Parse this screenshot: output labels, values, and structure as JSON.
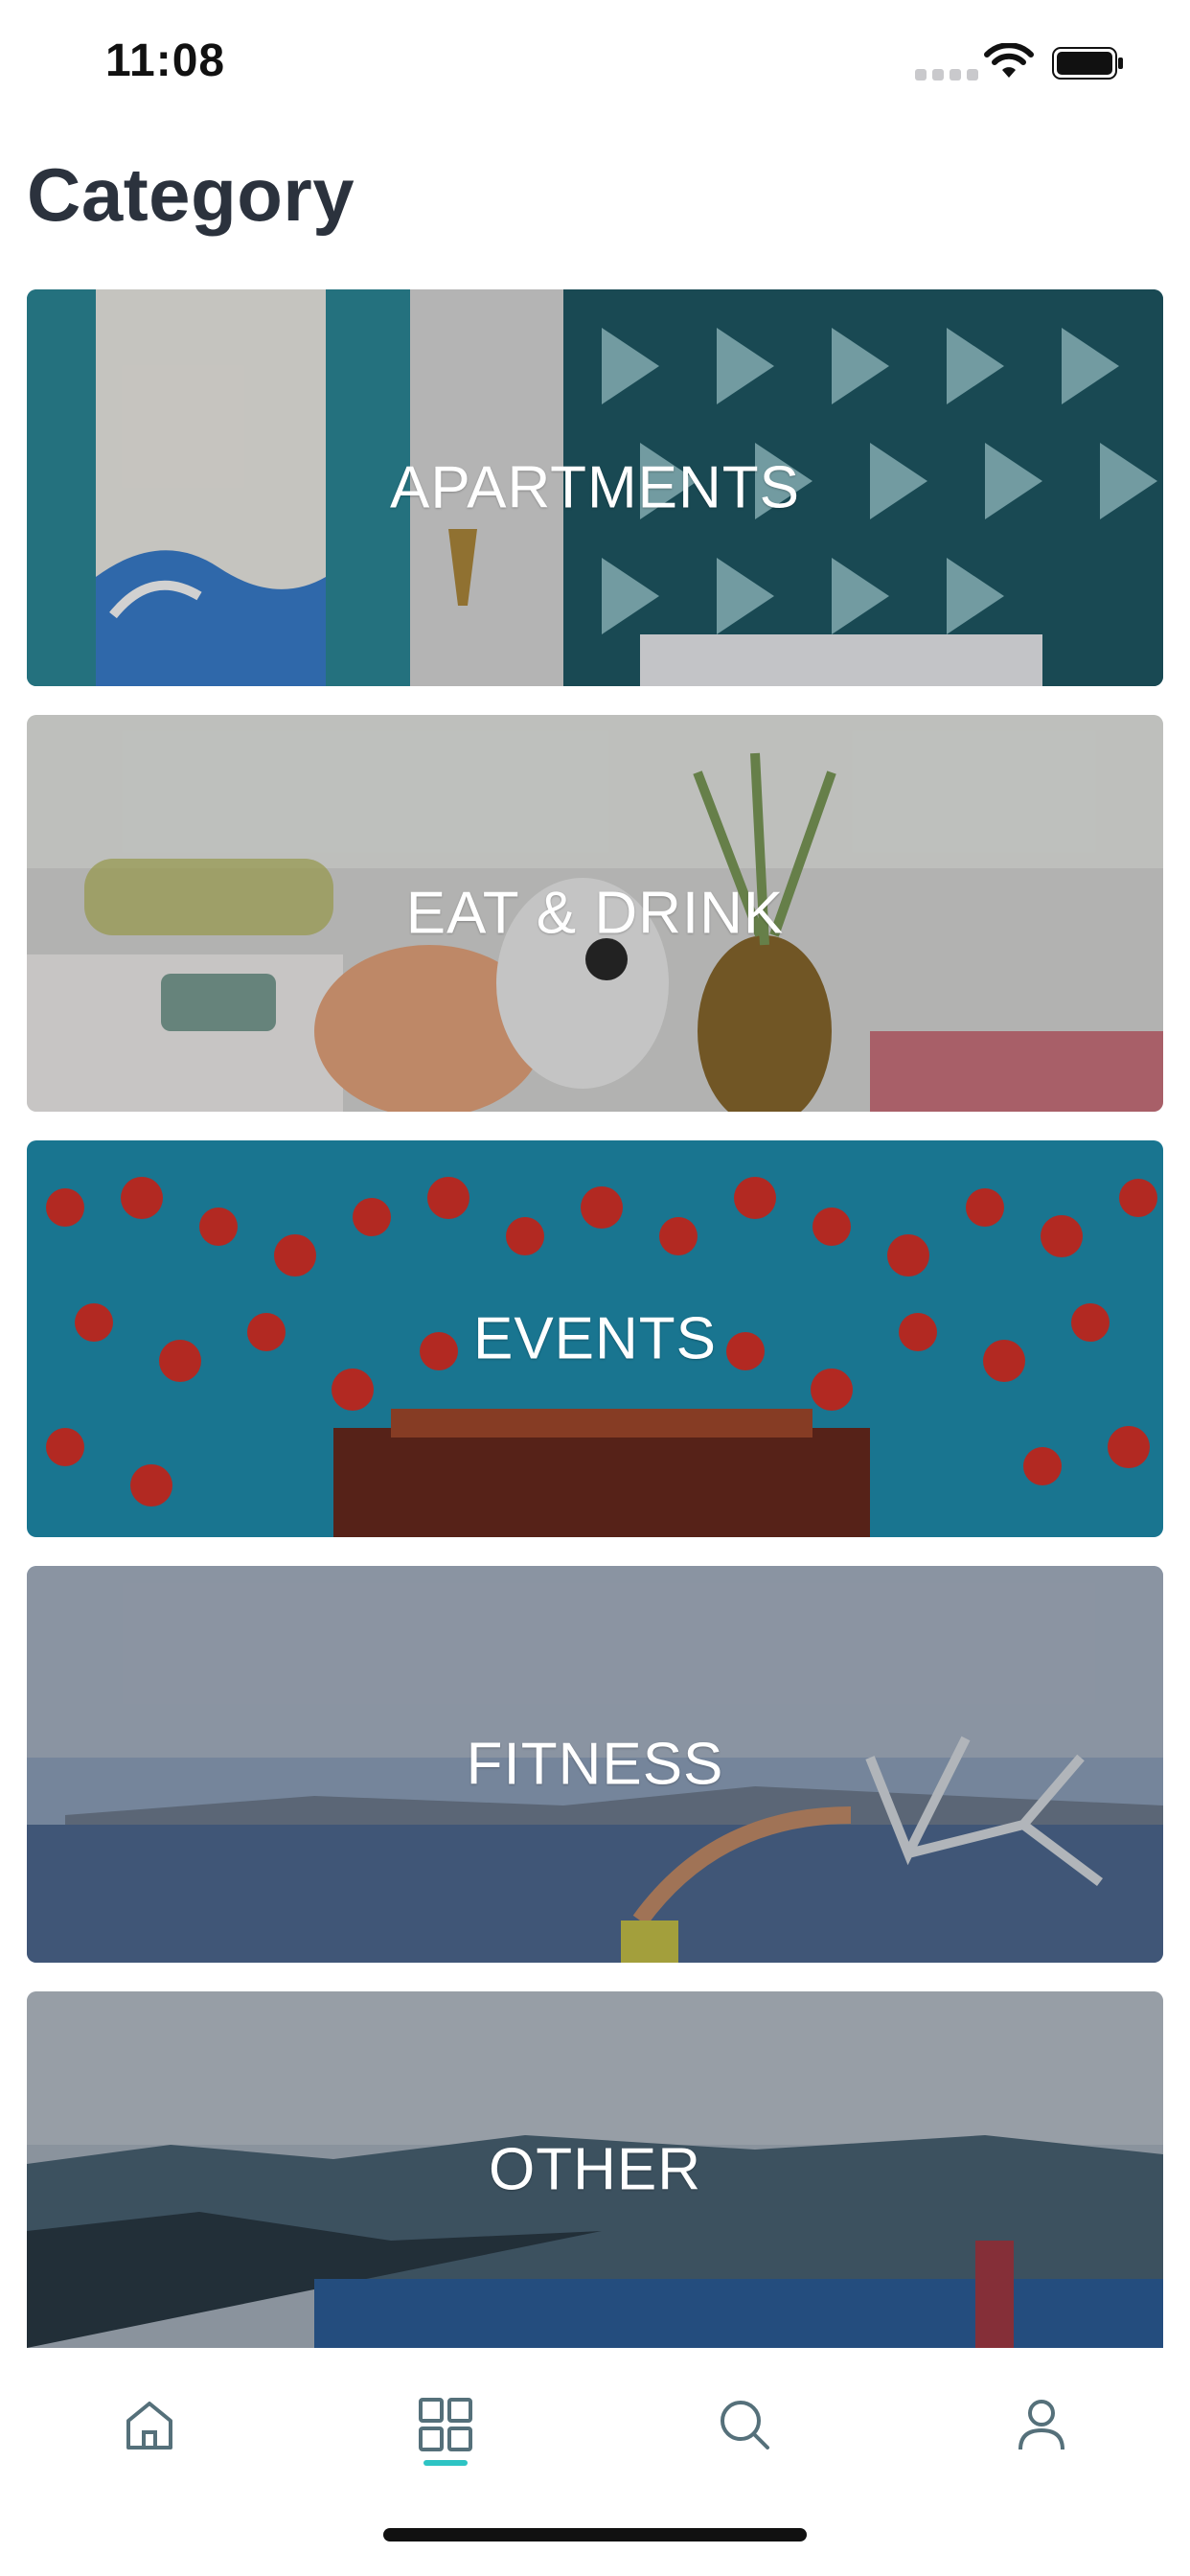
{
  "status_bar": {
    "time": "11:08"
  },
  "header": {
    "title": "Category"
  },
  "categories": [
    {
      "label": "APARTMENTS"
    },
    {
      "label": "EAT & DRINK"
    },
    {
      "label": "EVENTS"
    },
    {
      "label": "FITNESS"
    },
    {
      "label": "OTHER"
    }
  ],
  "tab_bar": {
    "items": [
      {
        "icon": "home-icon"
      },
      {
        "icon": "grid-icon",
        "active": true
      },
      {
        "icon": "search-icon"
      },
      {
        "icon": "profile-icon"
      }
    ],
    "accent_color": "#2ec4c4",
    "icon_color": "#55707a"
  }
}
